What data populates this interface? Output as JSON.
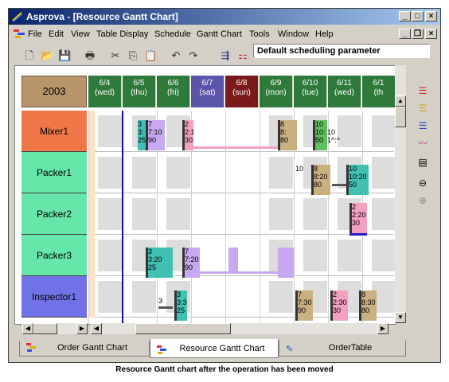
{
  "window": {
    "title": "Asprova - [Resource Gantt Chart]",
    "controls": {
      "minimize": "_",
      "maximize": "□",
      "close": "×"
    },
    "child_controls": {
      "minimize": "_",
      "restore": "❐",
      "close": "×"
    }
  },
  "menu": [
    "File",
    "Edit",
    "View",
    "Table Display",
    "Schedule",
    "Gantt Chart",
    "Tools",
    "Window",
    "Help"
  ],
  "toolbar": {
    "parameter": "Default scheduling parameter"
  },
  "gantt": {
    "year": "2003",
    "days": [
      {
        "date": "6/4",
        "dow": "(wed)",
        "color": "#2f7a3a"
      },
      {
        "date": "6/5",
        "dow": "(thu)",
        "color": "#2f7a3a"
      },
      {
        "date": "6/6",
        "dow": "(fri)",
        "color": "#2f7a3a"
      },
      {
        "date": "6/7",
        "dow": "(sat)",
        "color": "#5a55a8"
      },
      {
        "date": "6/8",
        "dow": "(sun)",
        "color": "#7a1a1a"
      },
      {
        "date": "6/9",
        "dow": "(mon)",
        "color": "#2f7a3a"
      },
      {
        "date": "6/10",
        "dow": "(tue)",
        "color": "#2f7a3a"
      },
      {
        "date": "6/11",
        "dow": "(wed)",
        "color": "#2f7a3a"
      },
      {
        "date": "6/1",
        "dow": "(th",
        "color": "#2f7a3a"
      }
    ],
    "resources": [
      {
        "name": "Mixer1",
        "color": "#f07848"
      },
      {
        "name": "Packer1",
        "color": "#66e6a8"
      },
      {
        "name": "Packer2",
        "color": "#66e6a8"
      },
      {
        "name": "Packer3",
        "color": "#66e6a8"
      },
      {
        "name": "Inspector1",
        "color": "#7272e8"
      }
    ],
    "tasks": {
      "mixer_a1": "3",
      "mixer_a2": "3:",
      "mixer_a3": "25",
      "mixer_b1": "7",
      "mixer_b2": "7:10",
      "mixer_b3": "90",
      "mixer_c1": "2",
      "mixer_c2": "2:10",
      "mixer_c3": "30",
      "mixer_d1": "8",
      "mixer_d2": "8:",
      "mixer_d3": "80",
      "mixer_e1": "10",
      "mixer_e2": "10:",
      "mixer_e3": "50",
      "mixer_f1": "10",
      "mixer_f2": "1^:^",
      "packer1_a1": "8",
      "packer1_a2": "8:20",
      "packer1_a3": "80",
      "packer1_b1": "10",
      "packer1_b2": "10:20",
      "packer1_b3": "50",
      "packer1_c1": "10",
      "packer1_mark": "...",
      "packer1_mark2": "...",
      "packer2_a1": "2",
      "packer2_a2": "2:20",
      "packer2_a3": "30",
      "packer3_a1": "3",
      "packer3_a2": "3:20",
      "packer3_a3": "25",
      "packer3_b1": "7",
      "packer3_b2": "7:20",
      "packer3_b3": "90",
      "insp_a1": "3",
      "insp_b1": "3",
      "insp_b2": "3:30",
      "insp_b3": "25",
      "insp_c1": "7",
      "insp_c2": "7:30",
      "insp_c3": "90",
      "insp_d1": "2",
      "insp_d2": "2:30",
      "insp_d3": "30",
      "insp_e1": "8",
      "insp_e2": "8:30",
      "insp_e3": "80"
    }
  },
  "tabs": [
    "Order Gantt Chart",
    "Resource Gantt Chart",
    "OrderTable"
  ],
  "caption": "Resource Gantt chart after the operation has been moved"
}
